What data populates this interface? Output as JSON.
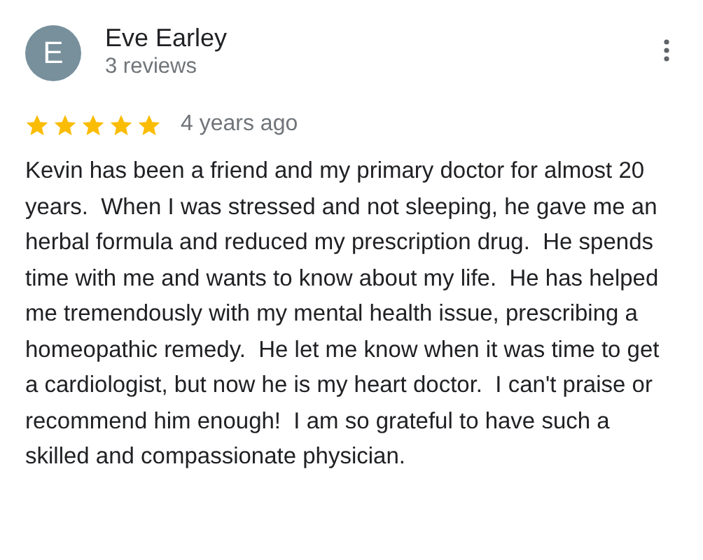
{
  "review": {
    "author": {
      "initial": "E",
      "name": "Eve Earley",
      "meta": "3 reviews"
    },
    "stars": 5,
    "time": "4 years ago",
    "text": "Kevin has been a friend and my primary doctor for almost 20 years.  When I was stressed and not sleeping, he gave me an herbal formula and reduced my prescription drug.  He spends time with me and wants to know about my life.  He has helped me tremendously with my mental health issue, prescribing a homeopathic remedy.  He let me know when it was time to get a cardiologist, but now he is my heart doctor.  I can't praise or recommend him enough!  I am so grateful to have such a skilled and compassionate physician."
  }
}
